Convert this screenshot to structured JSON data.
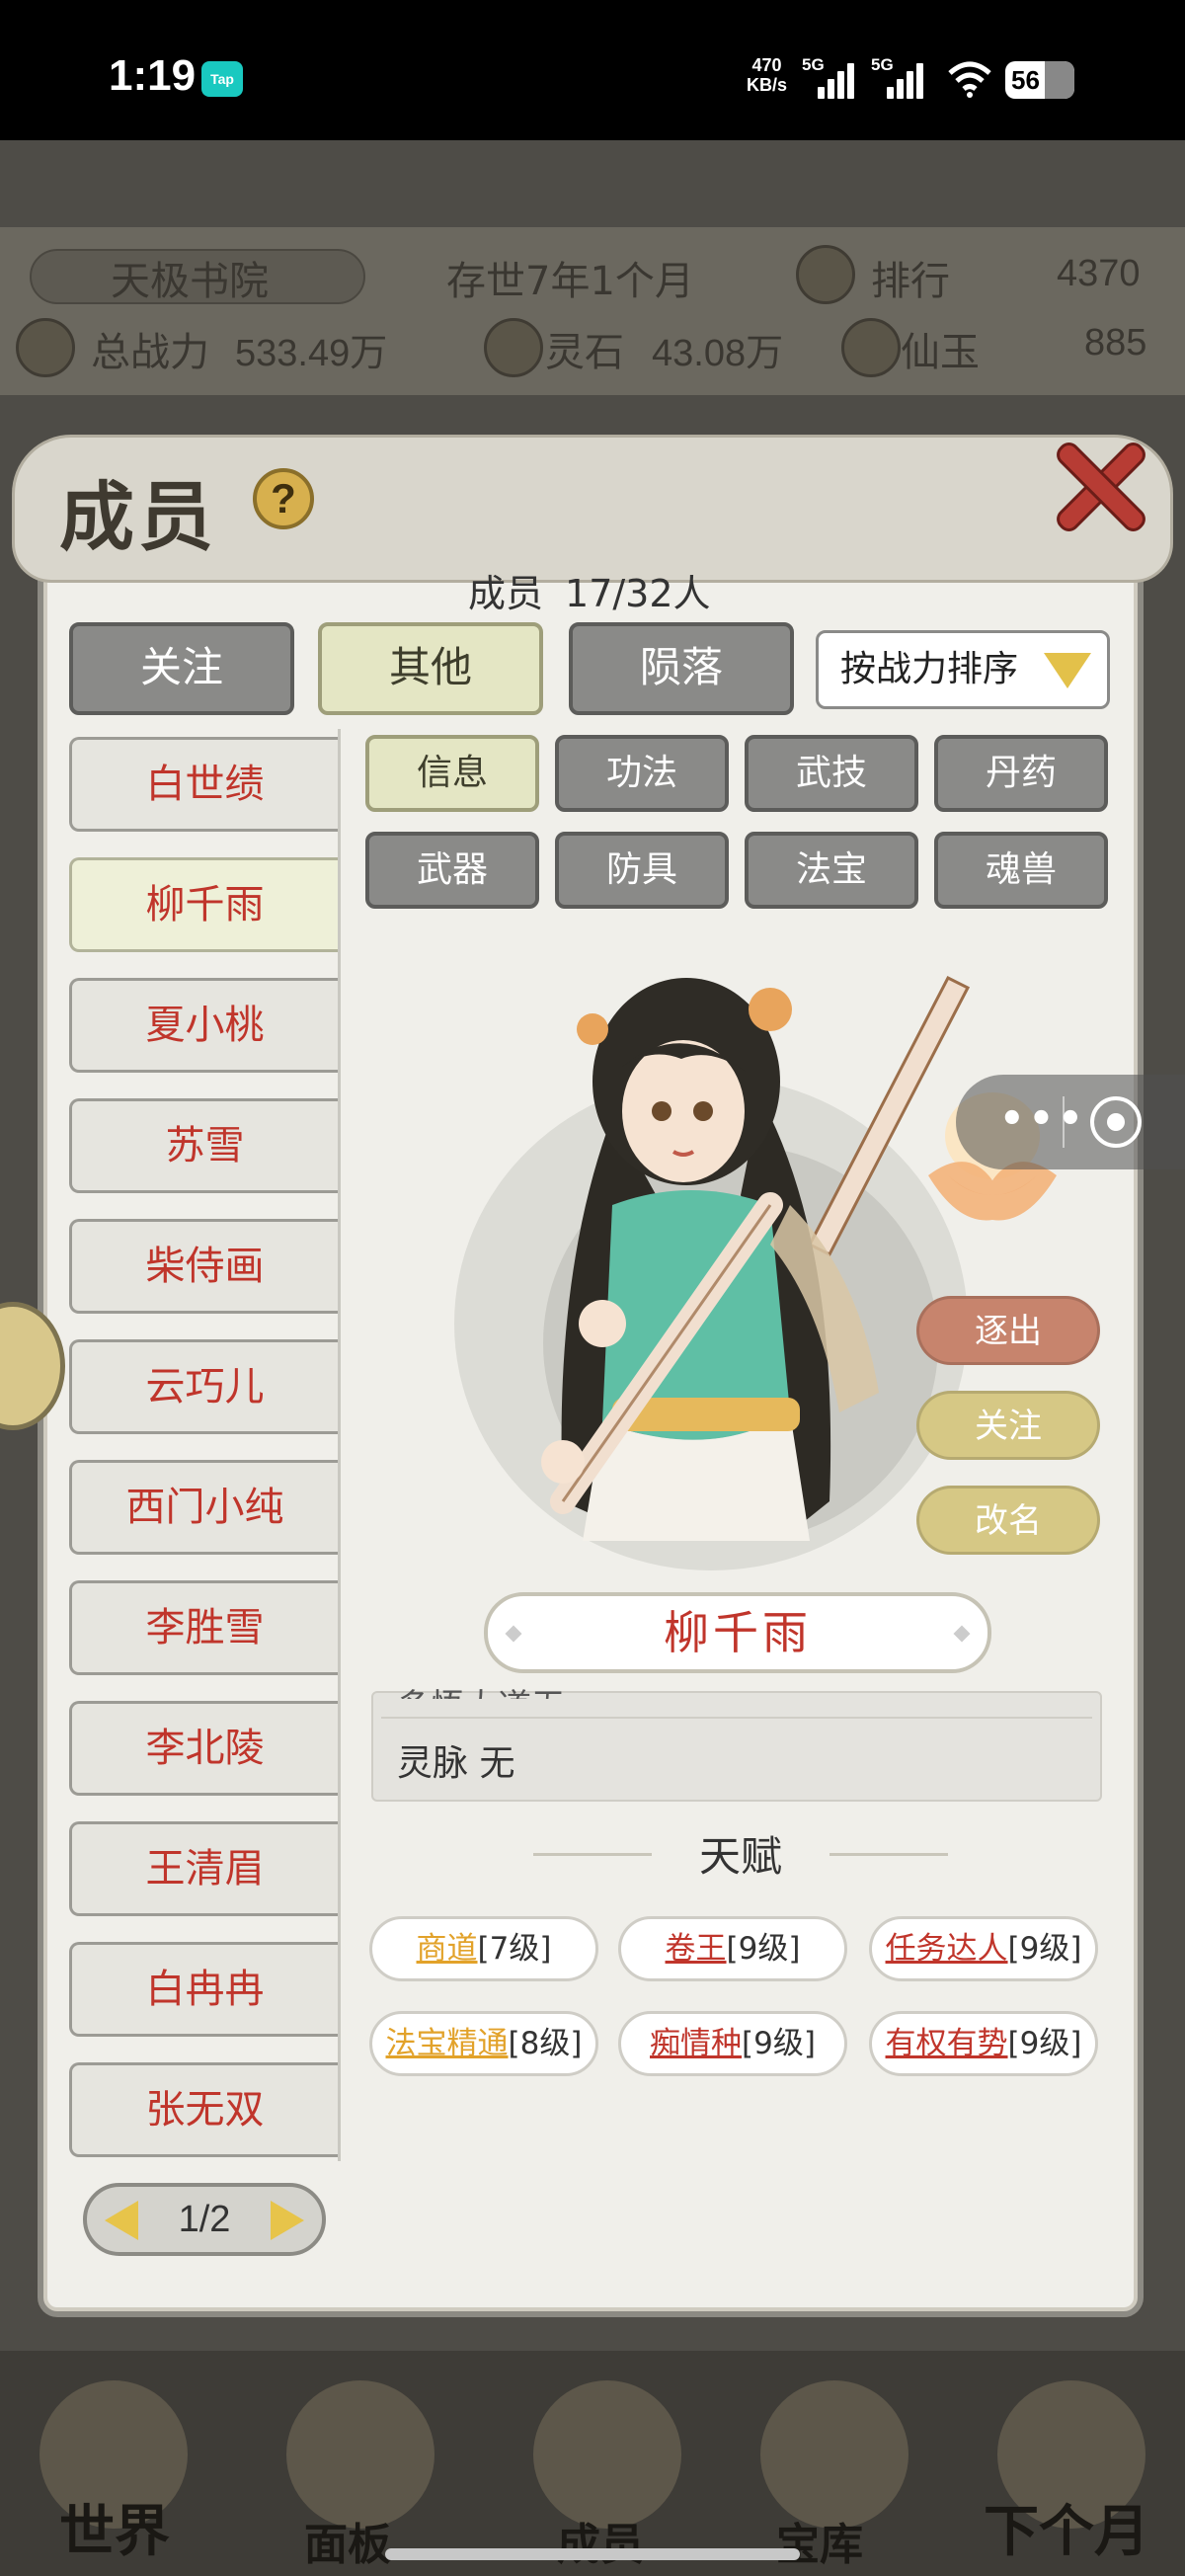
{
  "status": {
    "time": "1:19",
    "tap_badge": "Tap",
    "speed_value": "470",
    "speed_unit": "KB/s",
    "net1": "5G",
    "net2": "5G",
    "battery": "56"
  },
  "header": {
    "sect": "天极书院",
    "age": "存世7年1个月",
    "rank_label": "排行",
    "rank_value": "4370",
    "power_label": "总战力",
    "power_value": "533.49万",
    "stone_label": "灵石",
    "stone_value": "43.08万",
    "jade_label": "仙玉",
    "jade_value": "885"
  },
  "modal": {
    "title": "成员",
    "help": "?",
    "count_label": "成员",
    "count_value": "17/32人",
    "filter_tabs": [
      "关注",
      "其他",
      "陨落"
    ],
    "active_filter": 1,
    "sort_label": "按战力排序",
    "members": [
      "白世绩",
      "柳千雨",
      "夏小桃",
      "苏雪",
      "柴侍画",
      "云巧儿",
      "西门小纯",
      "李胜雪",
      "李北陵",
      "王清眉",
      "白冉冉",
      "张无双"
    ],
    "selected_member": 1,
    "sub_tabs": [
      "信息",
      "功法",
      "武技",
      "丹药",
      "武器",
      "防具",
      "法宝",
      "魂兽"
    ],
    "active_sub_tab": 0,
    "character_name": "柳千雨",
    "side_actions": {
      "expel": "逐出",
      "follow": "关注",
      "rename": "改名"
    },
    "info_cut_text": "多悟大道无",
    "info_line": "灵脉 无",
    "talent_title": "天赋",
    "talents": [
      {
        "name": "商道",
        "level": "[7级]",
        "color": "gold"
      },
      {
        "name": "卷王",
        "level": "[9级]",
        "color": "red"
      },
      {
        "name": "任务达人",
        "level": "[9级]",
        "color": "red"
      },
      {
        "name": "法宝精通",
        "level": "[8级]",
        "color": "gold"
      },
      {
        "name": "痴情种",
        "level": "[9级]",
        "color": "red"
      },
      {
        "name": "有权有势",
        "level": "[9级]",
        "color": "red"
      }
    ],
    "pager": "1/2"
  },
  "bottom_nav": [
    "世界",
    "面板",
    "成员",
    "宝库",
    "下个月"
  ],
  "colors": {
    "accent_red": "#c0352b",
    "talent_gold": "#e2a22a",
    "active_tab": "#e4e6c4",
    "inactive_tab": "#8a8a88"
  }
}
